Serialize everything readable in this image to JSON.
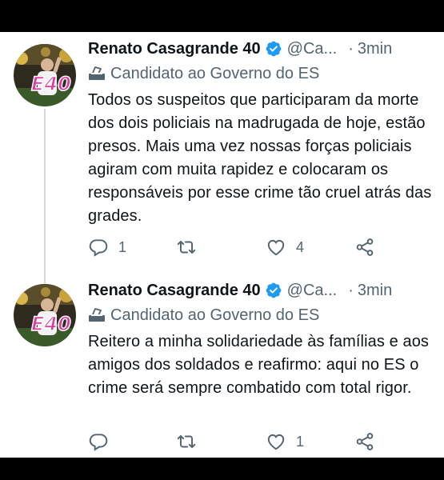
{
  "tweets": [
    {
      "name": "Renato Casagrande 40",
      "handle": "@Ca...",
      "dot": "·",
      "time": "3min",
      "label": "Candidato ao Governo do ES",
      "avatar_text": "E40",
      "text": "Todos os suspeitos que participaram da morte dos dois policiais na madrugada de hoje, estão presos. Mais uma vez nossas forças policiais agiram com muita rapidez e colocaram os responsáveis por esse crime tão cruel atrás das grades.",
      "actions": {
        "replies": "1",
        "retweets": "",
        "likes": "4"
      }
    },
    {
      "name": "Renato Casagrande 40",
      "handle": "@Ca...",
      "dot": "·",
      "time": "3min",
      "label": "Candidato ao Governo do ES",
      "avatar_text": "E40",
      "text": "Reitero a minha solidariedade às famílias e aos amigos dos soldados e reafirmo: aqui no ES o crime será sempre combatido com total rigor.",
      "actions": {
        "replies": "",
        "retweets": "",
        "likes": "1"
      }
    }
  ],
  "colors": {
    "verified": "#1d9bf0",
    "secondary_text": "#536471",
    "thread_line": "#cfd9de",
    "avatar_text": "#e0389f"
  },
  "icons": [
    "verified-badge-icon",
    "ballot-box-icon",
    "reply-icon",
    "retweet-icon",
    "like-icon",
    "share-icon"
  ]
}
